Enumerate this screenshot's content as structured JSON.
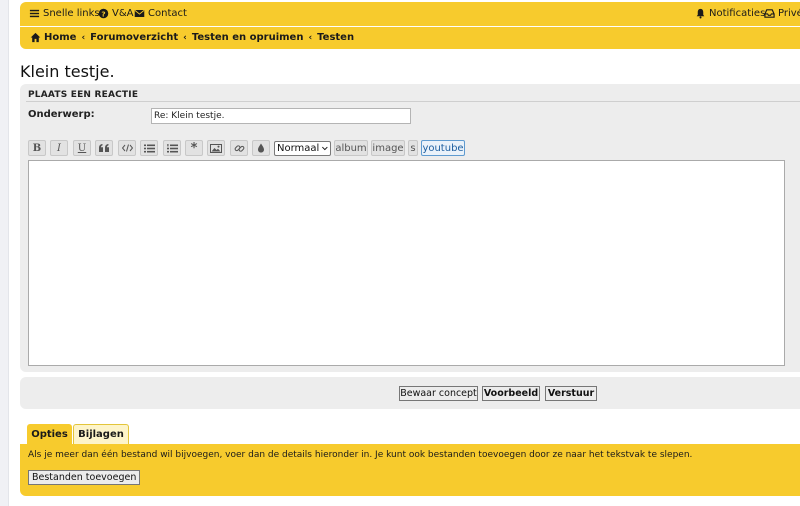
{
  "topnav": {
    "quicklinks": "Snelle links",
    "faq": "V&A",
    "contact": "Contact",
    "notifications": "Notificaties",
    "private": "Privé"
  },
  "breadcrumbs": [
    "Home",
    "Forumoverzicht",
    "Testen en opruimen",
    "Testen"
  ],
  "page": {
    "title": "Klein testje."
  },
  "post": {
    "heading": "PLAATS EEN REACTIE",
    "subject_label": "Onderwerp:",
    "subject_value": "Re: Klein testje.",
    "font_size": "Normaal",
    "tags": {
      "album": "album",
      "image": "image",
      "s": "s",
      "youtube": "youtube"
    },
    "message_value": ""
  },
  "actions": {
    "save_draft": "Bewaar concept",
    "preview": "Voorbeeld",
    "submit": "Verstuur"
  },
  "tabs": {
    "options": "Opties",
    "attachments": "Bijlagen"
  },
  "attachments": {
    "help": "Als je meer dan één bestand wil bijvoegen, voer dan de details hieronder in. Je kunt ook bestanden toevoegen door ze naar het tekstvak te slepen.",
    "add_button": "Bestanden toevoegen"
  },
  "colors": {
    "accent": "#f7cb2d",
    "panel": "#ededed",
    "youtube_border": "#5f9bd0"
  }
}
